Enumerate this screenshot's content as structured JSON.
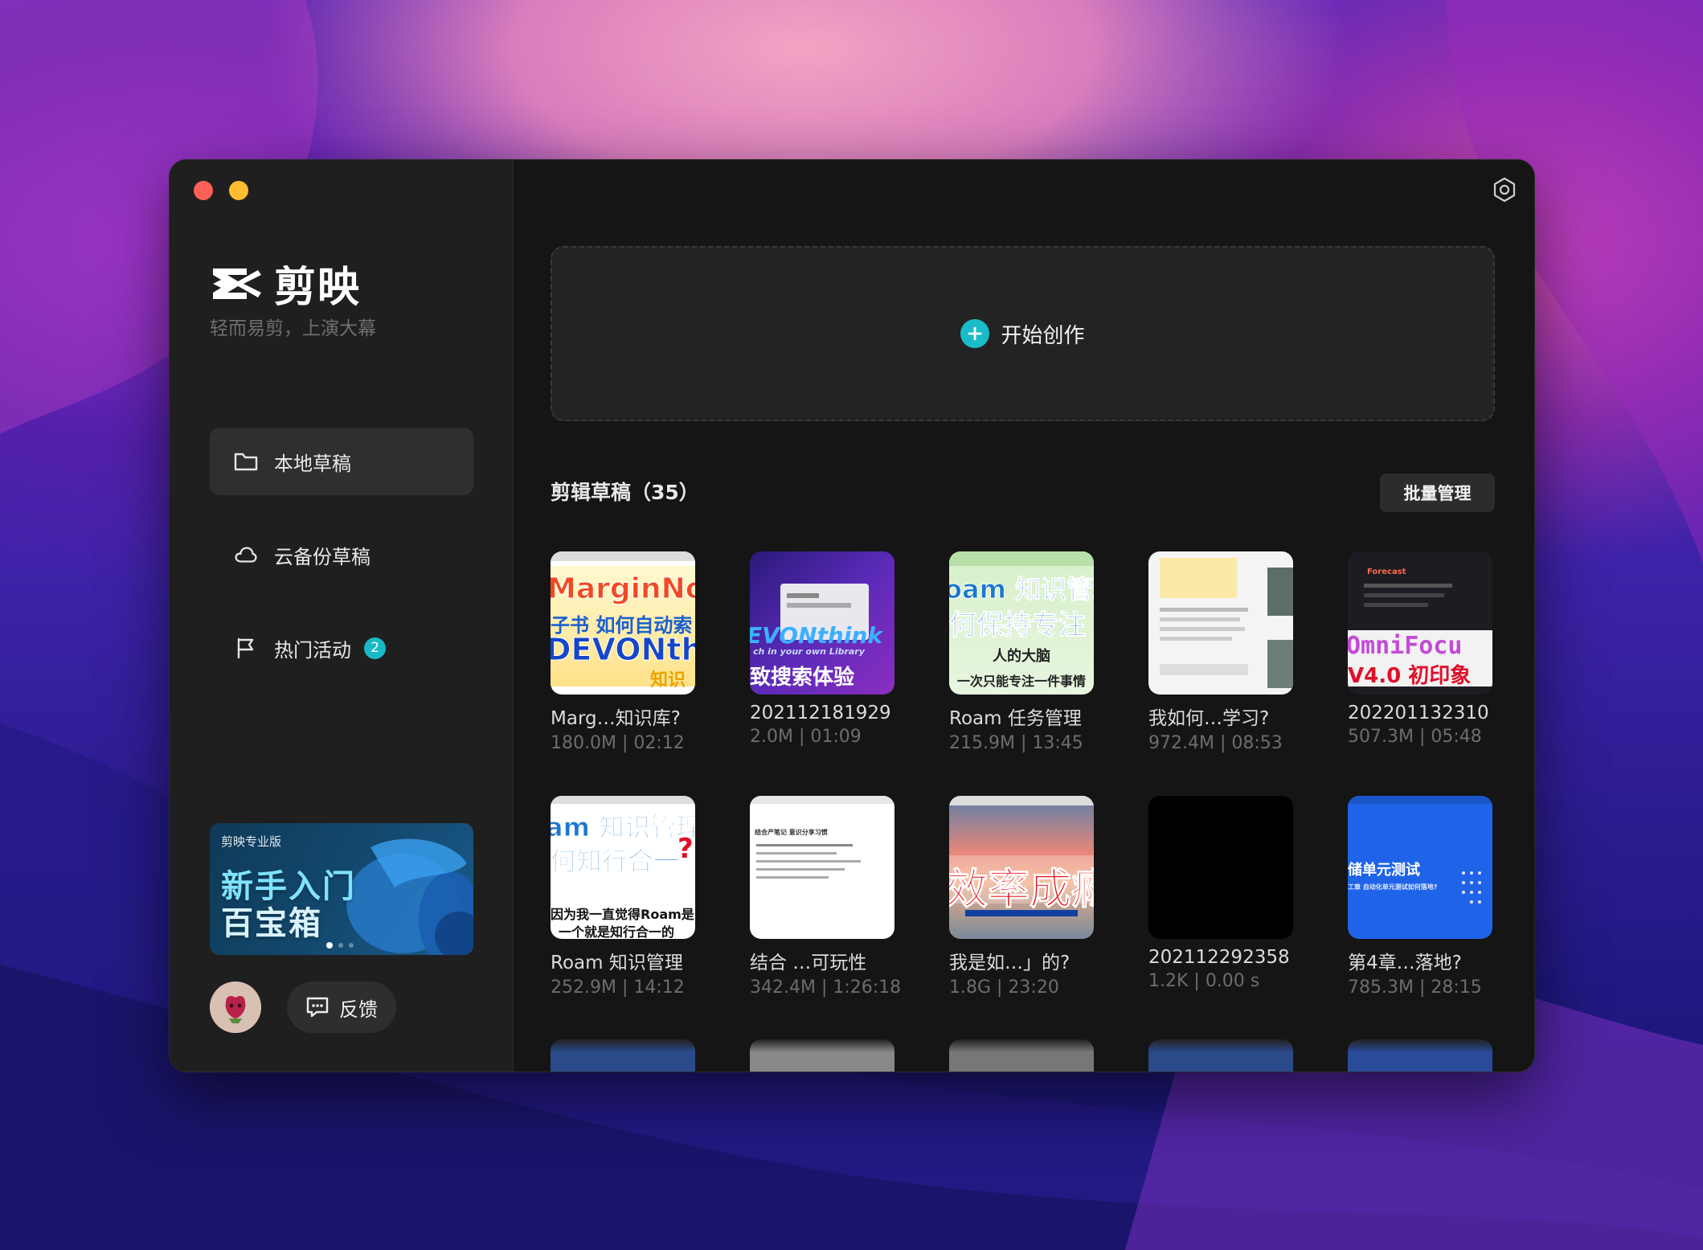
{
  "app": {
    "name": "剪映",
    "tagline": "轻而易剪，上演大幕"
  },
  "sidebar": {
    "items": [
      {
        "label": "本地草稿",
        "icon": "folder-icon",
        "active": true
      },
      {
        "label": "云备份草稿",
        "icon": "cloud-icon",
        "active": false
      },
      {
        "label": "热门活动",
        "icon": "flag-icon",
        "active": false,
        "badge": "2"
      }
    ],
    "banner": {
      "brand": "剪映专业版",
      "line1": "新手入门",
      "line2": "百宝箱"
    },
    "feedback_label": "反馈"
  },
  "main": {
    "create_label": "开始创作",
    "drafts_title": "剪辑草稿（35）",
    "batch_label": "批量管理",
    "drafts": [
      {
        "name": "Marg…知识库?",
        "meta": "180.0M | 02:12"
      },
      {
        "name": "202112181929",
        "meta": "2.0M | 01:09"
      },
      {
        "name": "Roam 任务管理",
        "meta": "215.9M | 13:45"
      },
      {
        "name": "我如何…学习?",
        "meta": "972.4M | 08:53"
      },
      {
        "name": "202201132310",
        "meta": "507.3M | 05:48"
      },
      {
        "name": "Roam 知识管理",
        "meta": "252.9M | 14:12"
      },
      {
        "name": "结合 …可玩性",
        "meta": "342.4M | 1:26:18"
      },
      {
        "name": "我是如…」的?",
        "meta": "1.8G | 23:20"
      },
      {
        "name": "202112292358",
        "meta": "1.2K | 0.00 s"
      },
      {
        "name": "第4章…落地?",
        "meta": "785.3M | 28:15"
      }
    ],
    "thumbs": {
      "t1": [
        "MarginNote",
        "子书 如何自动索",
        "DEVONthir",
        "知识"
      ],
      "t2": [
        "EVONthink",
        "ch in your own Library",
        "致搜索体验"
      ],
      "t3": [
        "oam 知识管理",
        "何保持专注",
        "人的大脑",
        "一次只能专注一件事情"
      ],
      "t5": [
        "Forecast",
        "OmniFocu",
        "V4.0 初印象"
      ],
      "t6": [
        "am 知识管理",
        "何知行合一",
        "因为我一直觉得Roam是",
        "一个就是知行合一的"
      ],
      "t7": [
        "结合产笔记 意识分享习惯"
      ],
      "t8": [
        "效率成瘾"
      ],
      "t10": [
        "储单元测试",
        "工章 自动化单元测试如何落地?"
      ]
    }
  },
  "colors": {
    "accent": "#1bbcc9",
    "window_bg": "#151515",
    "sidebar_bg": "#1f1f1f"
  }
}
